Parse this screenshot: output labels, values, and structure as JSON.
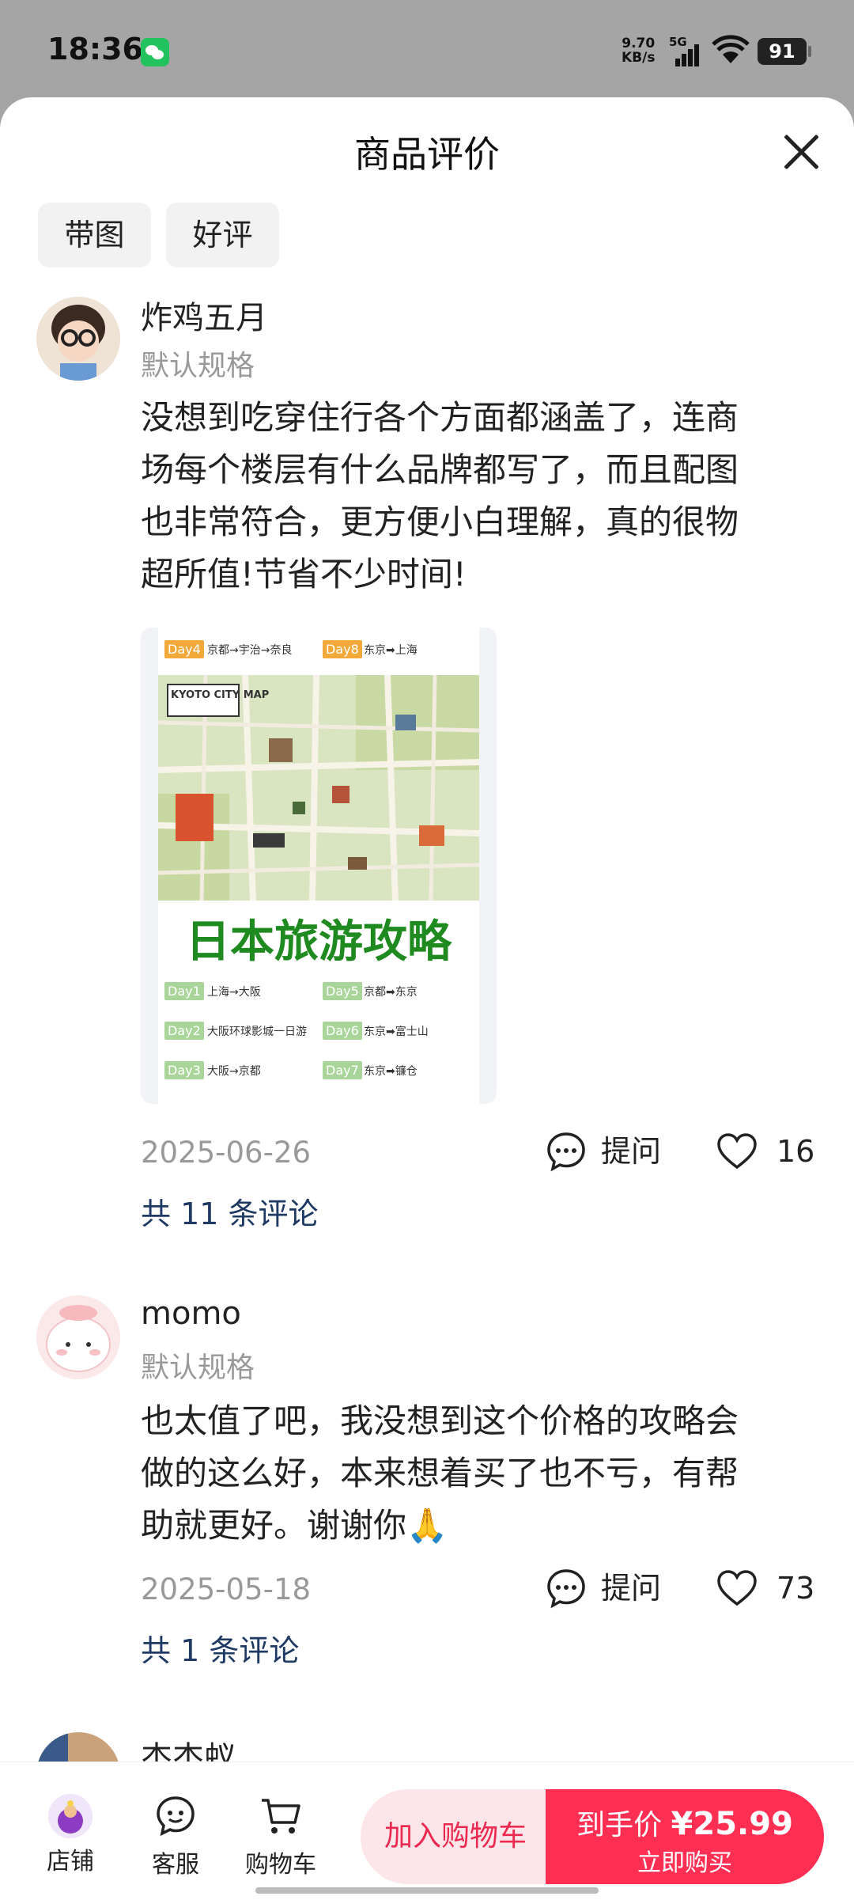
{
  "status_bar": {
    "time": "18:36",
    "net_speed_value": "9.70",
    "net_speed_unit": "KB/s",
    "network": "5G",
    "battery": "91"
  },
  "sheet": {
    "title": "商品评价"
  },
  "filters": [
    "带图",
    "好评"
  ],
  "reviews": [
    {
      "username": "炸鸡五月",
      "spec": "默认规格",
      "text_lines": [
        "没想到吃穿住行各个方面都涵盖了，连商",
        "场每个楼层有什么品牌都写了，而且配图",
        "也非常符合，更方便小白理解，真的很物",
        "超所值!节省不少时间!"
      ],
      "date": "2025-06-26",
      "ask_label": "提问",
      "likes": "16",
      "comments": "共 11 条评论",
      "image": {
        "top_rows": [
          {
            "day": "Day4",
            "text": "京都→宇治→奈良"
          },
          {
            "day": "Day8",
            "text": "东京➡上海"
          }
        ],
        "map_label": "KYOTO CITY MAP",
        "title": "日本旅游攻略",
        "rows": [
          {
            "day": "Day1",
            "text": "上海→大阪"
          },
          {
            "day": "Day5",
            "text": "京都➡东京"
          },
          {
            "day": "Day2",
            "text": "大阪环球影城一日游"
          },
          {
            "day": "Day6",
            "text": "东京➡富士山"
          },
          {
            "day": "Day3",
            "text": "大阪→京都"
          },
          {
            "day": "Day7",
            "text": "东京➡镰仓"
          }
        ]
      }
    },
    {
      "username": "momo",
      "spec": "默认规格",
      "text_lines": [
        "也太值了吧，我没想到这个价格的攻略会",
        "做的这么好，本来想着买了也不亏，有帮",
        "助就更好。谢谢你🙏"
      ],
      "date": "2025-05-18",
      "ask_label": "提问",
      "likes": "73",
      "comments": "共 1 条评论"
    },
    {
      "username": "杰杰蚁"
    }
  ],
  "bottom_bar": {
    "shop": "店铺",
    "service": "客服",
    "cart": "购物车",
    "add_to_cart": "加入购物车",
    "price_prefix": "到手价",
    "price": "¥25.99",
    "buy_now": "立即购买"
  },
  "colors": {
    "accent": "#ff2f54",
    "link": "#1e3a64",
    "muted": "#999999"
  }
}
